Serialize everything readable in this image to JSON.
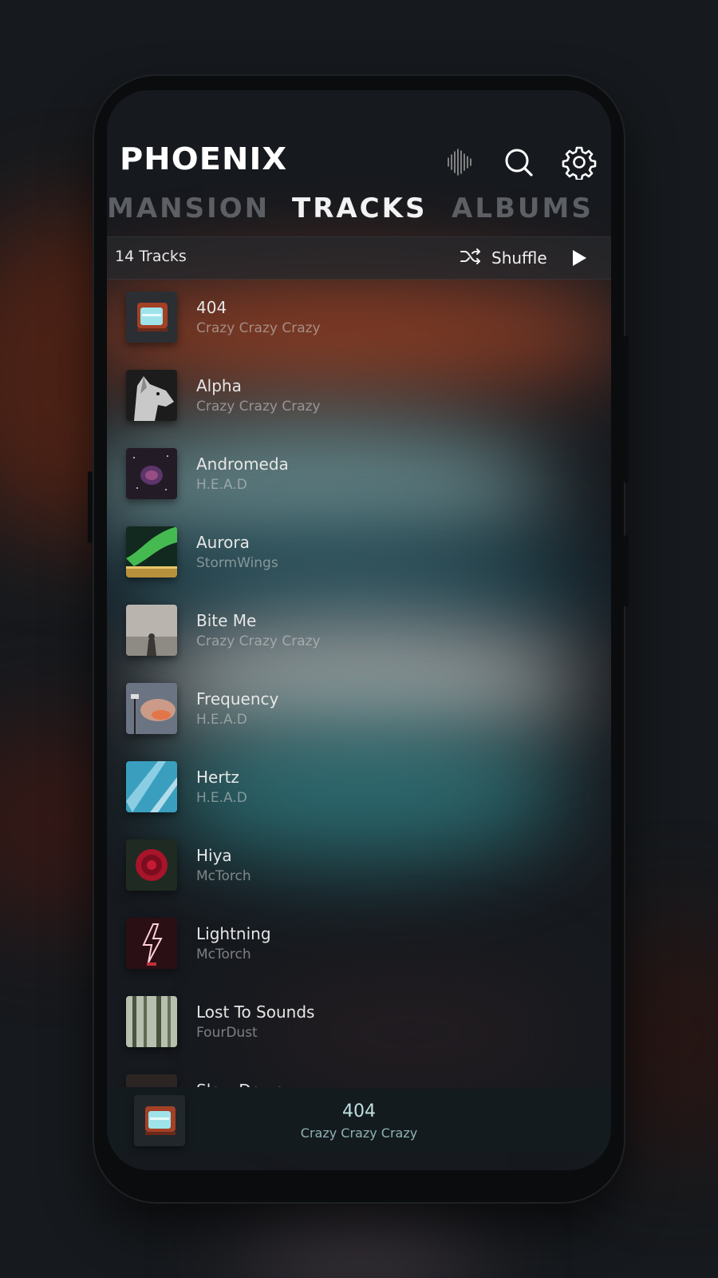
{
  "app": {
    "logo": "PHOENIX",
    "header_icons": [
      "equalizer-icon",
      "search-icon",
      "settings-icon"
    ]
  },
  "tabs": [
    {
      "label": "MANSION",
      "active": false
    },
    {
      "label": "TRACKS",
      "active": true
    },
    {
      "label": "ALBUMS",
      "active": false
    }
  ],
  "toolbar": {
    "count": "14 Tracks",
    "shuffle_label": "Shuffle",
    "shuffle_icon": "shuffle-icon",
    "play_icon": "play-icon"
  },
  "tracks": [
    {
      "title": "404",
      "artist": "Crazy Crazy Crazy",
      "art": "tv-art"
    },
    {
      "title": "Alpha",
      "artist": "Crazy Crazy Crazy",
      "art": "wolf-art"
    },
    {
      "title": "Andromeda",
      "artist": "H.E.A.D",
      "art": "nebula-art"
    },
    {
      "title": "Aurora",
      "artist": "StormWings",
      "art": "aurora-art"
    },
    {
      "title": "Bite Me",
      "artist": "Crazy Crazy Crazy",
      "art": "fog-art"
    },
    {
      "title": "Frequency",
      "artist": "H.E.A.D",
      "art": "storm-art"
    },
    {
      "title": "Hertz",
      "artist": "H.E.A.D",
      "art": "ice-art"
    },
    {
      "title": "Hiya",
      "artist": "McTorch",
      "art": "rose-art"
    },
    {
      "title": "Lightning",
      "artist": "McTorch",
      "art": "neon-bolt-art"
    },
    {
      "title": "Lost To Sounds",
      "artist": "FourDust",
      "art": "forest-art"
    },
    {
      "title": "Slow Down",
      "artist": "",
      "art": "road-art"
    }
  ],
  "now_playing": {
    "title": "404",
    "artist": "Crazy Crazy Crazy",
    "art": "tv-art"
  },
  "colors": {
    "background": "#16191d",
    "accent": "#bfe0e0",
    "active_tab": "#f2f2f2",
    "inactive_tab": "#5c5f63"
  }
}
